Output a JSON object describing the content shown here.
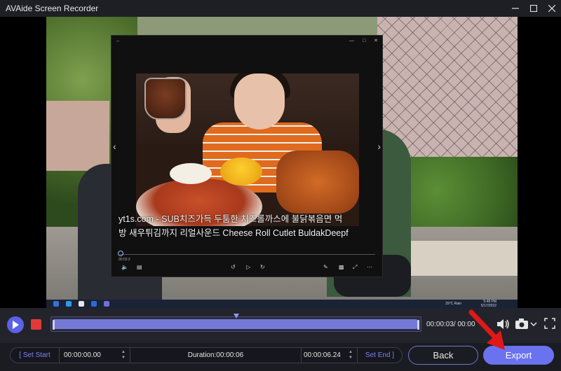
{
  "window": {
    "title": "AVAide Screen Recorder",
    "controls": [
      "minimize-icon",
      "maximize-icon",
      "close-icon"
    ]
  },
  "recording_preview": {
    "caption_line1": "yt1s.com - SUB치즈가득 두툼한 치즈롤까스에 불닭볶음면 먹",
    "caption_line2": "방 새우튀김까지 리얼사운드 Cheese Roll Cutlet BuldakDeepf",
    "player_time": "00:02:2",
    "taskbar_weather": "29°C Rain",
    "taskbar_clock": "5:48 PM",
    "taskbar_date": "5/17/2022"
  },
  "timeline": {
    "timecode": "00:00:03/ 00:00",
    "playhead_fraction": 0.5
  },
  "trim": {
    "set_start_label": "[ Set Start",
    "start_time": "00:00:00.00",
    "duration": "Duration:00:00:06",
    "end_time": "00:00:06.24",
    "set_end_label": "Set End ]"
  },
  "actions": {
    "back_label": "Back",
    "export_label": "Export"
  },
  "colors": {
    "accent": "#6a72f0",
    "stop": "#e03a3a",
    "annotation_arrow": "#e01818"
  }
}
